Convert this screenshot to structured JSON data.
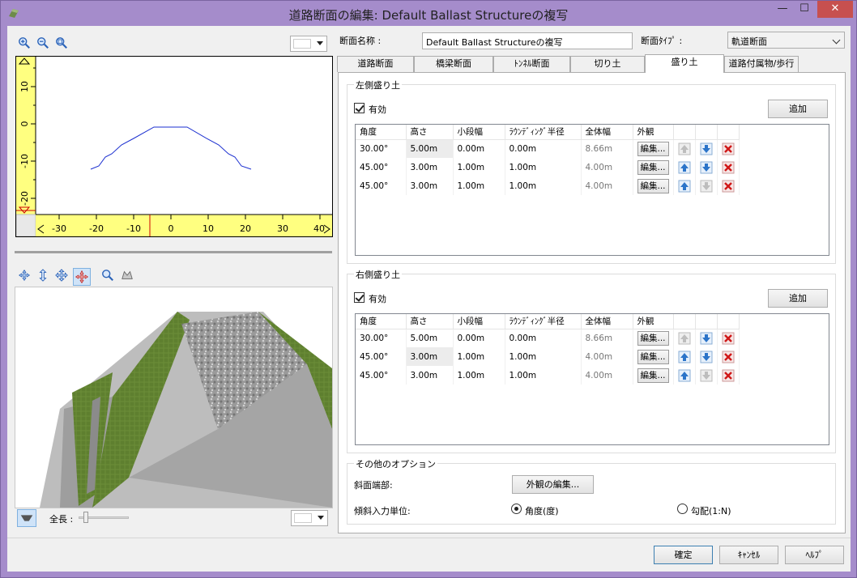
{
  "window": {
    "title": "道路断面の編集: Default Ballast Structureの複写",
    "minimize": "—",
    "maximize": "☐",
    "close": "✕"
  },
  "plot2d": {
    "x_ticks": [
      "-30",
      "-20",
      "-10",
      "0",
      "10",
      "20",
      "30",
      "40"
    ],
    "y_ticks": [
      "10",
      "0",
      "-10",
      "-20"
    ]
  },
  "view3d": {
    "length_label": "全長 :"
  },
  "form": {
    "name_label": "断面名称 :",
    "name_value": "Default Ballast Structureの複写",
    "type_label": "断面ﾀｲﾌﾟ :",
    "type_value": "軌道断面"
  },
  "tabs": [
    {
      "label": "道路断面"
    },
    {
      "label": "橋梁断面"
    },
    {
      "label": "ﾄﾝﾈﾙ断面"
    },
    {
      "label": "切り土"
    },
    {
      "label": "盛り土"
    },
    {
      "label": "道路付属物/歩行"
    }
  ],
  "columns": [
    "角度",
    "高さ",
    "小段幅",
    "ﾗｳﾝﾃﾞｨﾝｸﾞ半径",
    "全体幅",
    "外観"
  ],
  "edit_label": "編集...",
  "left_fill": {
    "title": "左側盛り土",
    "enabled_label": "有効",
    "add_label": "追加",
    "rows": [
      {
        "angle": "30.00°",
        "height": "5.00m",
        "bench": "0.00m",
        "radius": "0.00m",
        "width": "8.66m"
      },
      {
        "angle": "45.00°",
        "height": "3.00m",
        "bench": "1.00m",
        "radius": "1.00m",
        "width": "4.00m"
      },
      {
        "angle": "45.00°",
        "height": "3.00m",
        "bench": "1.00m",
        "radius": "1.00m",
        "width": "4.00m"
      }
    ]
  },
  "right_fill": {
    "title": "右側盛り土",
    "enabled_label": "有効",
    "add_label": "追加",
    "rows": [
      {
        "angle": "30.00°",
        "height": "5.00m",
        "bench": "0.00m",
        "radius": "0.00m",
        "width": "8.66m"
      },
      {
        "angle": "45.00°",
        "height": "3.00m",
        "bench": "1.00m",
        "radius": "1.00m",
        "width": "4.00m"
      },
      {
        "angle": "45.00°",
        "height": "3.00m",
        "bench": "1.00m",
        "radius": "1.00m",
        "width": "4.00m"
      }
    ]
  },
  "other_options": {
    "title": "その他のオプション",
    "slope_end_label": "斜面端部:",
    "edit_appearance": "外観の編集...",
    "slope_unit_label": "傾斜入力単位:",
    "angle_option": "角度(度)",
    "gradient_option": "勾配(1:N)"
  },
  "footer": {
    "ok": "確定",
    "cancel": "ｷｬﾝｾﾙ",
    "help": "ﾍﾙﾌﾟ"
  }
}
